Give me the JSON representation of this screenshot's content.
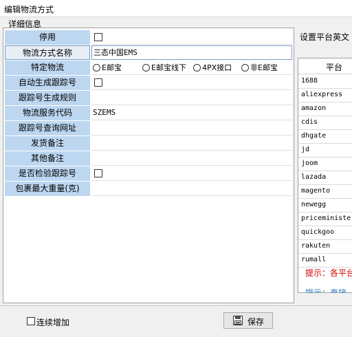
{
  "window": {
    "title": "编辑物流方式"
  },
  "tab": {
    "label": "详细信息"
  },
  "form": {
    "fields": [
      {
        "label": "停用",
        "type": "checkbox"
      },
      {
        "label": "物流方式名称",
        "type": "text",
        "value": "三态中国EMS"
      },
      {
        "label": "特定物流",
        "type": "radio",
        "options": [
          "E邮宝",
          "E邮宝线下",
          "4PX接口",
          "非E邮宝"
        ]
      },
      {
        "label": "自动生成跟踪号",
        "type": "checkbox"
      },
      {
        "label": "跟踪号生成规则",
        "type": "text",
        "value": ""
      },
      {
        "label": "物流服务代码",
        "type": "text",
        "value": "SZEMS"
      },
      {
        "label": "跟踪号查询网址",
        "type": "text",
        "value": ""
      },
      {
        "label": "发货备注",
        "type": "text",
        "value": ""
      },
      {
        "label": "其他备注",
        "type": "text",
        "value": ""
      },
      {
        "label": "是否检验跟踪号",
        "type": "checkbox"
      },
      {
        "label": "包裹最大重量(克)",
        "type": "text",
        "value": ""
      }
    ]
  },
  "platform_panel": {
    "title": "设置平台英文",
    "column_header": "平台",
    "rows": [
      "1688",
      "aliexpress",
      "amazon",
      "cdis",
      "dhgate",
      "jd",
      "joom",
      "lazada",
      "magento",
      "newegg",
      "priceminister",
      "quickgoo",
      "rakuten",
      "rumall"
    ],
    "hint_red": "提示：各平台",
    "hint_blue": "提示：直接"
  },
  "bottom": {
    "continuous_add_label": "连续增加",
    "save_label": "保存"
  }
}
